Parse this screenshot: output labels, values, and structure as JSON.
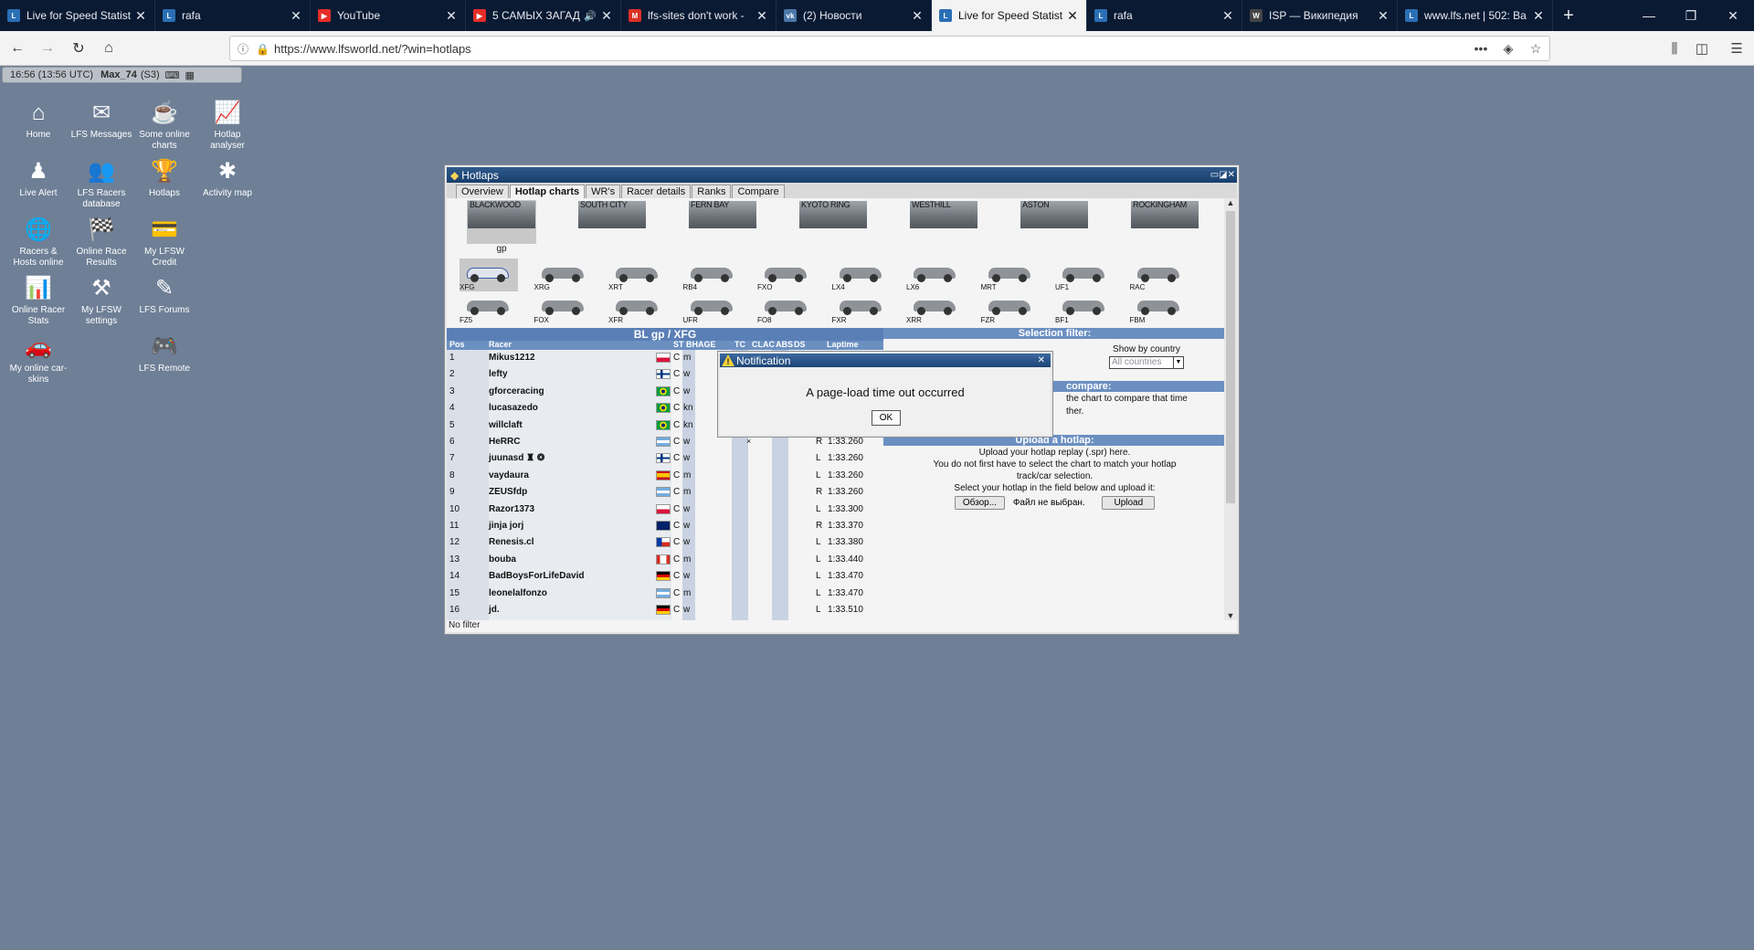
{
  "browser": {
    "tabs": [
      {
        "title": "Live for Speed Statist",
        "fav_color": "#2a6fb5",
        "fav": "L",
        "active": false,
        "sound": false
      },
      {
        "title": "rafa",
        "fav_color": "#2a6fb5",
        "fav": "L",
        "active": false,
        "sound": false
      },
      {
        "title": "YouTube",
        "fav_color": "#e52d27",
        "fav": "▶",
        "active": false,
        "sound": false
      },
      {
        "title": "5 САМЫХ ЗАГАД",
        "fav_color": "#e52d27",
        "fav": "▶",
        "active": false,
        "sound": true
      },
      {
        "title": "lfs-sites don't work -",
        "fav_color": "#d93025",
        "fav": "M",
        "active": false,
        "sound": false
      },
      {
        "title": "(2) Новости",
        "fav_color": "#4a76a8",
        "fav": "vk",
        "active": false,
        "sound": false
      },
      {
        "title": "Live for Speed Statist",
        "fav_color": "#2a6fb5",
        "fav": "L",
        "active": true,
        "sound": false
      },
      {
        "title": "rafa",
        "fav_color": "#2a6fb5",
        "fav": "L",
        "active": false,
        "sound": false
      },
      {
        "title": "ISP — Википедия",
        "fav_color": "#444444",
        "fav": "W",
        "active": false,
        "sound": false
      },
      {
        "title": "www.lfs.net | 502: Ba",
        "fav_color": "#2a6fb5",
        "fav": "L",
        "active": false,
        "sound": false
      }
    ],
    "url": "https://www.lfsworld.net/?win=hotlaps"
  },
  "statusbar": {
    "time": "16:56 (13:56 UTC)",
    "user": "Max_74",
    "server": "(S3)"
  },
  "desktop_icons": [
    {
      "label": "Home",
      "icon": "home-icon",
      "glyph": "⌂"
    },
    {
      "label": "LFS Messages",
      "icon": "messages-icon",
      "glyph": "✉"
    },
    {
      "label": "Some online charts",
      "icon": "coffee-icon",
      "glyph": "☕"
    },
    {
      "label": "Hotlap analyser",
      "icon": "analyser-icon",
      "glyph": "📈"
    },
    {
      "label": "Live Alert",
      "icon": "alert-icon",
      "glyph": "♟"
    },
    {
      "label": "LFS Racers database",
      "icon": "racers-db-icon",
      "glyph": "👥"
    },
    {
      "label": "Hotlaps",
      "icon": "trophy-icon",
      "glyph": "🏆"
    },
    {
      "label": "Activity map",
      "icon": "activity-map-icon",
      "glyph": "✱"
    },
    {
      "label": "Racers & Hosts online",
      "icon": "globe-icon",
      "glyph": "🌐"
    },
    {
      "label": "Online Race Results",
      "icon": "race-results-icon",
      "glyph": "🏁"
    },
    {
      "label": "My LFSW Credit",
      "icon": "credit-icon",
      "glyph": "💳"
    },
    {
      "label": "Online Racer Stats",
      "icon": "racer-stats-icon",
      "glyph": "📊"
    },
    {
      "label": "My LFSW settings",
      "icon": "settings-icon",
      "glyph": "⚒"
    },
    {
      "label": "LFS Forums",
      "icon": "forums-icon",
      "glyph": "✎"
    },
    {
      "label": "My online car-skins",
      "icon": "car-skins-icon",
      "glyph": "🚗"
    },
    {
      "label": "LFS Remote",
      "icon": "remote-icon",
      "glyph": "🎮"
    }
  ],
  "hotlaps": {
    "title": "Hotlaps",
    "tabs": [
      "Overview",
      "Hotlap charts",
      "WR's",
      "Racer details",
      "Ranks",
      "Compare"
    ],
    "active_tab": 1,
    "tracks": [
      "BLACKWOOD",
      "SOUTH CITY",
      "FERN BAY",
      "KYOTO RING",
      "WESTHILL",
      "ASTON",
      "ROCKINGHAM"
    ],
    "selected_track_config": "gp",
    "cars": [
      "XFG",
      "XRG",
      "XRT",
      "RB4",
      "FXO",
      "LX4",
      "LX6",
      "MRT",
      "UF1",
      "RAC",
      "FZ5",
      "FOX",
      "XFR",
      "UFR",
      "FO8",
      "FXR",
      "XRR",
      "FZR",
      "BF1",
      "FBM"
    ],
    "chart": {
      "title": "BL gp / XFG",
      "cols": {
        "pos": "Pos",
        "racer": "Racer",
        "st": "ST",
        "bhage": "BHAGE",
        "tc": "TC",
        "cl": "CL",
        "ac": "AC",
        "abs": "ABS",
        "ds": "DS",
        "laptime": "Laptime"
      },
      "rows": [
        {
          "pos": "1",
          "name": "Mikus1212",
          "flag": "pl",
          "st": "C",
          "type": "m",
          "lap": "",
          "time": "",
          "extra": ""
        },
        {
          "pos": "2",
          "name": "lefty",
          "flag": "fi",
          "st": "C",
          "type": "w",
          "lap": "",
          "time": "",
          "extra": ""
        },
        {
          "pos": "3",
          "name": "gforceracing",
          "flag": "br",
          "st": "C",
          "type": "w",
          "lap": "",
          "time": "",
          "extra": ""
        },
        {
          "pos": "4",
          "name": "lucasazedo",
          "flag": "br",
          "st": "C",
          "type": "kn",
          "lap": "",
          "time": "",
          "extra": ""
        },
        {
          "pos": "5",
          "name": "willclaft",
          "flag": "br",
          "st": "C",
          "type": "kn",
          "lap": "",
          "time": "",
          "extra": ""
        },
        {
          "pos": "6",
          "name": "HeRRC",
          "flag": "ar",
          "st": "C",
          "type": "w",
          "lap": "R",
          "time": "1:33.260",
          "extra": "×"
        },
        {
          "pos": "7",
          "name": "juunasd ♜ ❂",
          "flag": "fi",
          "st": "C",
          "type": "w",
          "lap": "L",
          "time": "1:33.260",
          "extra": ""
        },
        {
          "pos": "8",
          "name": "vaydaura",
          "flag": "es",
          "st": "C",
          "type": "m",
          "lap": "L",
          "time": "1:33.260",
          "extra": ""
        },
        {
          "pos": "9",
          "name": "ZEUSfdp",
          "flag": "ar",
          "st": "C",
          "type": "m",
          "lap": "R",
          "time": "1:33.260",
          "extra": ""
        },
        {
          "pos": "10",
          "name": "Razor1373",
          "flag": "pl",
          "st": "C",
          "type": "w",
          "lap": "L",
          "time": "1:33.300",
          "extra": ""
        },
        {
          "pos": "11",
          "name": "jinja jorj",
          "flag": "gb",
          "st": "C",
          "type": "w",
          "lap": "R",
          "time": "1:33.370",
          "extra": ""
        },
        {
          "pos": "12",
          "name": "Renesis.cl",
          "flag": "cl",
          "st": "C",
          "type": "w",
          "lap": "L",
          "time": "1:33.380",
          "extra": ""
        },
        {
          "pos": "13",
          "name": "bouba",
          "flag": "ca",
          "st": "C",
          "type": "m",
          "lap": "L",
          "time": "1:33.440",
          "extra": ""
        },
        {
          "pos": "14",
          "name": "BadBoysForLifeDavid",
          "flag": "de",
          "st": "C",
          "type": "w",
          "lap": "L",
          "time": "1:33.470",
          "extra": ""
        },
        {
          "pos": "15",
          "name": "leonelalfonzo",
          "flag": "ar",
          "st": "C",
          "type": "m",
          "lap": "L",
          "time": "1:33.470",
          "extra": ""
        },
        {
          "pos": "16",
          "name": "jd.",
          "flag": "de",
          "st": "C",
          "type": "w",
          "lap": "L",
          "time": "1:33.510",
          "extra": ""
        }
      ]
    },
    "filter": {
      "selection_filter": "Selection filter:",
      "show_label": "Show by country",
      "country_select": "All countries",
      "compare_head": "compare:",
      "compare_text1": "the chart to compare that time",
      "compare_text2": "ther.",
      "upload_head": "Upload a hotlap:",
      "upload_text1": "Upload your hotlap replay (.spr) here.",
      "upload_text2": "You do not first have to select the chart to match your hotlap",
      "upload_text3": "track/car selection.",
      "upload_text4": "Select your hotlap in the field below and upload it:",
      "browse_btn": "Обзор...",
      "no_file": "Файл не выбран.",
      "upload_btn": "Upload"
    },
    "footer": "No filter"
  },
  "notification": {
    "title": "Notification",
    "message": "A page-load time out occurred",
    "ok": "OK"
  },
  "colors": {
    "desktop": "#6e7f96",
    "titlebar": "#1d4476",
    "chart_header": "#5a7fb6"
  }
}
